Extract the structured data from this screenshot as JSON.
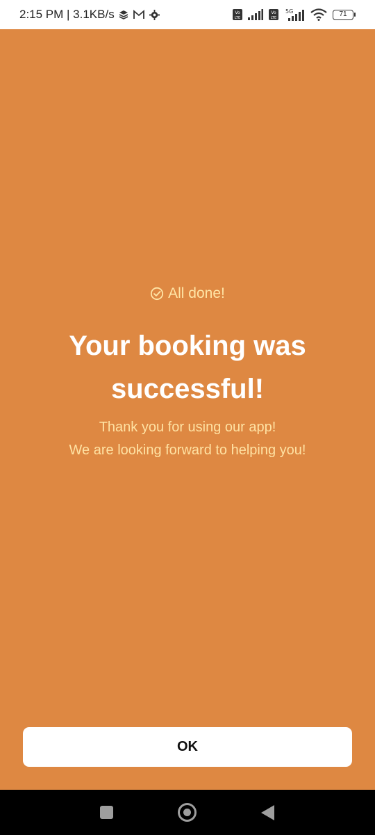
{
  "status_bar": {
    "time_speed": "2:15 PM | 3.1KB/s",
    "network_5g": "5G",
    "volte_label": "Vo LTE",
    "battery": "71"
  },
  "main": {
    "done_label": "All done!",
    "title_line1": "Your booking was",
    "title_line2": "successful!",
    "subtitle_line1": "Thank you for using our app!",
    "subtitle_line2": "We are looking forward to helping you!",
    "ok_button": "OK"
  },
  "colors": {
    "background": "#de8842",
    "accent_text": "#ffe5a6",
    "title_text": "#ffffff",
    "button_bg": "#ffffff"
  }
}
